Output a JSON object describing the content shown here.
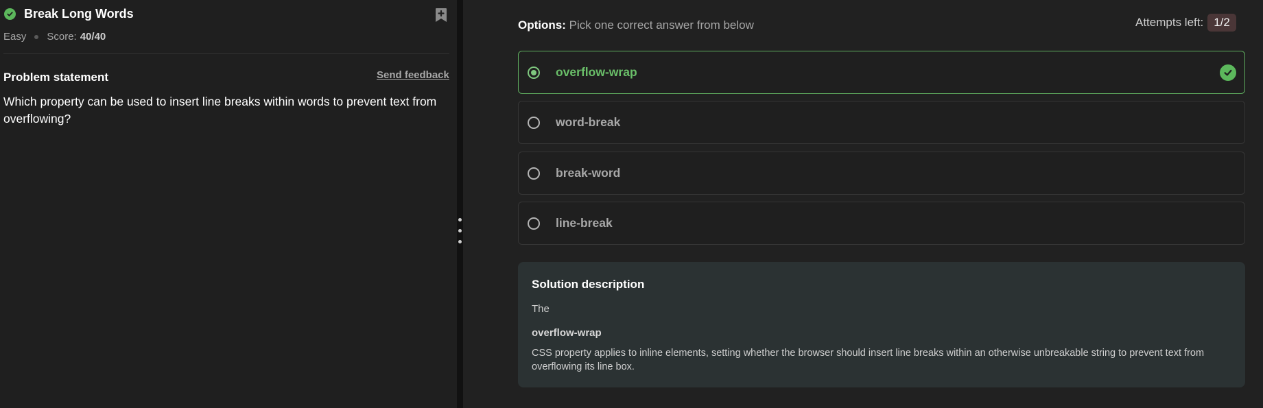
{
  "problem": {
    "title": "Break Long Words",
    "difficulty": "Easy",
    "score_label": "Score:",
    "score_value": "40/40",
    "statement_heading": "Problem statement",
    "feedback_link": "Send feedback",
    "question": "Which property can be used to insert line breaks within words to prevent text from overflowing?"
  },
  "options_panel": {
    "label_bold": "Options:",
    "label_text": "Pick one correct answer from below",
    "attempts_label": "Attempts left:",
    "attempts_value": "1/2",
    "options": [
      {
        "label": "overflow-wrap",
        "selected": true,
        "correct": true
      },
      {
        "label": "word-break",
        "selected": false,
        "correct": false
      },
      {
        "label": "break-word",
        "selected": false,
        "correct": false
      },
      {
        "label": "line-break",
        "selected": false,
        "correct": false
      }
    ]
  },
  "solution": {
    "heading": "Solution description",
    "text_intro": "The",
    "code": "overflow-wrap",
    "text_body": "CSS property applies to inline elements, setting whether the browser should insert line breaks within an otherwise unbreakable string to prevent text from overflowing its line box."
  },
  "icons": {
    "status": "check-circle-icon",
    "bookmark": "bookmark-add-icon",
    "correct": "check-circle-icon"
  },
  "colors": {
    "success": "#5cb85c",
    "correct_text": "#6abf69",
    "solution_bg": "#2b3233",
    "attempts_badge_bg": "#4a3637"
  }
}
